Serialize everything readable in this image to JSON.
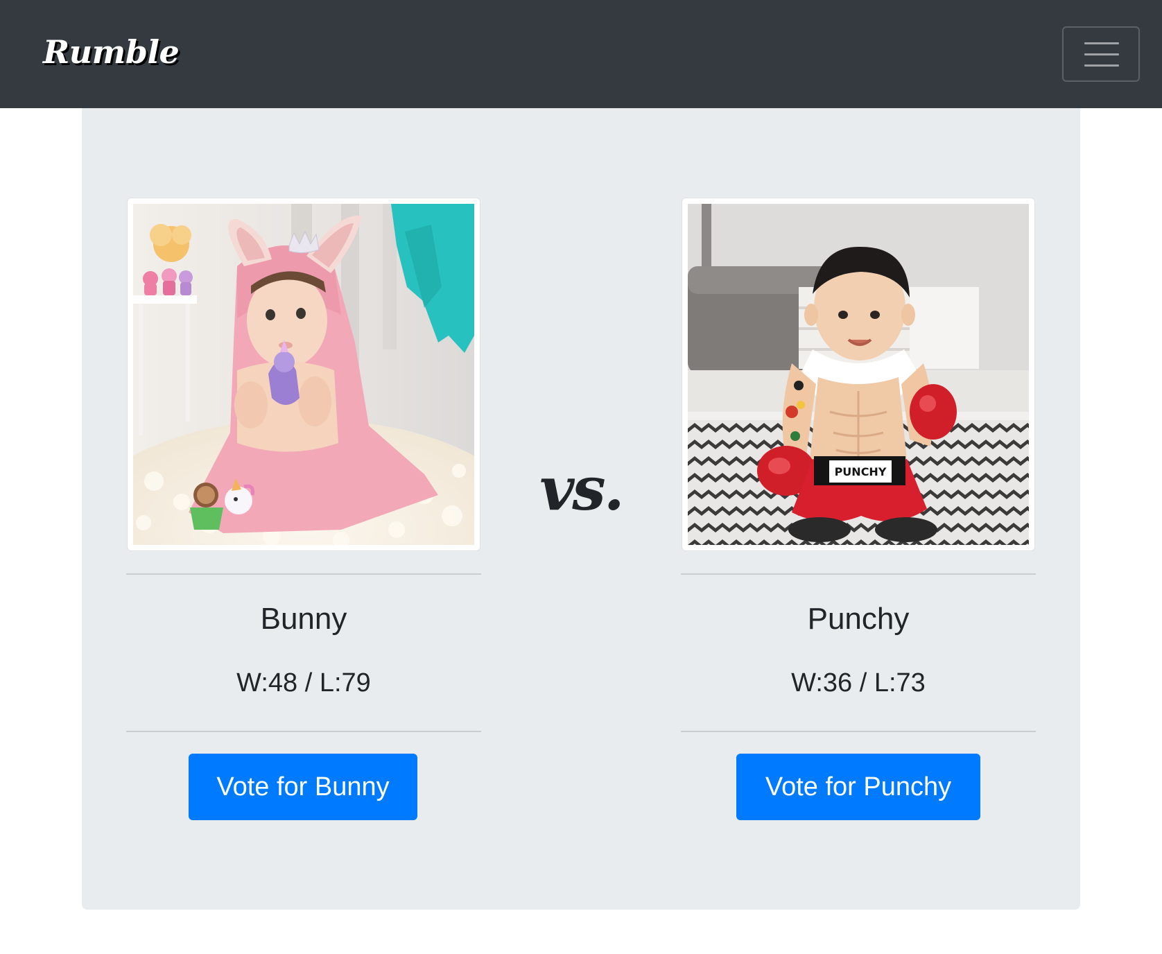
{
  "navbar": {
    "brand": "Rumble",
    "toggler_icon": "hamburger-menu-icon"
  },
  "versus_label": "vs.",
  "contestants": [
    {
      "name": "Bunny",
      "record": "W:48 / L:79",
      "vote_label": "Vote for Bunny",
      "photo": "baby in pink bunny-ear hooded towel holding a purple toy"
    },
    {
      "name": "Punchy",
      "record": "W:36 / L:73",
      "vote_label": "Vote for Punchy",
      "photo": "baby in boxer costume with red gloves and tattooed sleeves"
    }
  ],
  "colors": {
    "navbar_bg": "#343a40",
    "panel_bg": "#e9ecef",
    "button_bg": "#007bff",
    "text": "#212529"
  }
}
